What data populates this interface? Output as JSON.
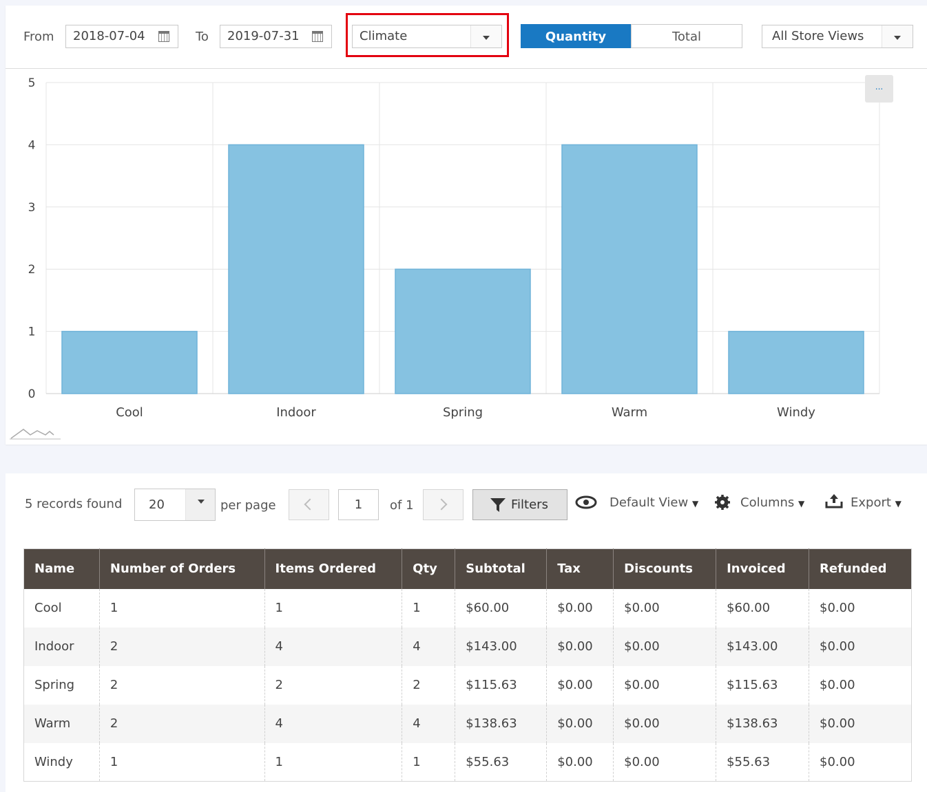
{
  "filters": {
    "from_label": "From",
    "from_value": "2018-07-04",
    "to_label": "To",
    "to_value": "2019-07-31",
    "attribute_value": "Climate",
    "toggle": {
      "quantity": "Quantity",
      "total": "Total",
      "active": "quantity"
    },
    "store_view": "All Store Views",
    "more_label": "..."
  },
  "chart_data": {
    "type": "bar",
    "categories": [
      "Cool",
      "Indoor",
      "Spring",
      "Warm",
      "Windy"
    ],
    "values": [
      1,
      4,
      2,
      4,
      1
    ],
    "ylim": [
      0,
      5
    ],
    "yticks": [
      "0",
      "1",
      "2",
      "3",
      "4",
      "5"
    ],
    "grid": true,
    "bar_color": "#86c2e1",
    "bar_border": "#6fb3d9"
  },
  "grid": {
    "records_found": "5 records found",
    "per_page_value": "20",
    "per_page_label": "per page",
    "page_value": "1",
    "page_of": "of 1",
    "filters_label": "Filters",
    "view_label": "Default View",
    "columns_label": "Columns",
    "export_label": "Export"
  },
  "table": {
    "headers": [
      "Name",
      "Number of Orders",
      "Items Ordered",
      "Qty",
      "Subtotal",
      "Tax",
      "Discounts",
      "Invoiced",
      "Refunded"
    ],
    "rows": [
      [
        "Cool",
        "1",
        "1",
        "1",
        "$60.00",
        "$0.00",
        "$0.00",
        "$60.00",
        "$0.00"
      ],
      [
        "Indoor",
        "2",
        "4",
        "4",
        "$143.00",
        "$0.00",
        "$0.00",
        "$143.00",
        "$0.00"
      ],
      [
        "Spring",
        "2",
        "2",
        "2",
        "$115.63",
        "$0.00",
        "$0.00",
        "$115.63",
        "$0.00"
      ],
      [
        "Warm",
        "2",
        "4",
        "4",
        "$138.63",
        "$0.00",
        "$0.00",
        "$138.63",
        "$0.00"
      ],
      [
        "Windy",
        "1",
        "1",
        "1",
        "$55.63",
        "$0.00",
        "$0.00",
        "$55.63",
        "$0.00"
      ]
    ]
  },
  "colors": {
    "accent": "#1979c3",
    "highlight": "#e3000f",
    "table_header": "#514943"
  }
}
